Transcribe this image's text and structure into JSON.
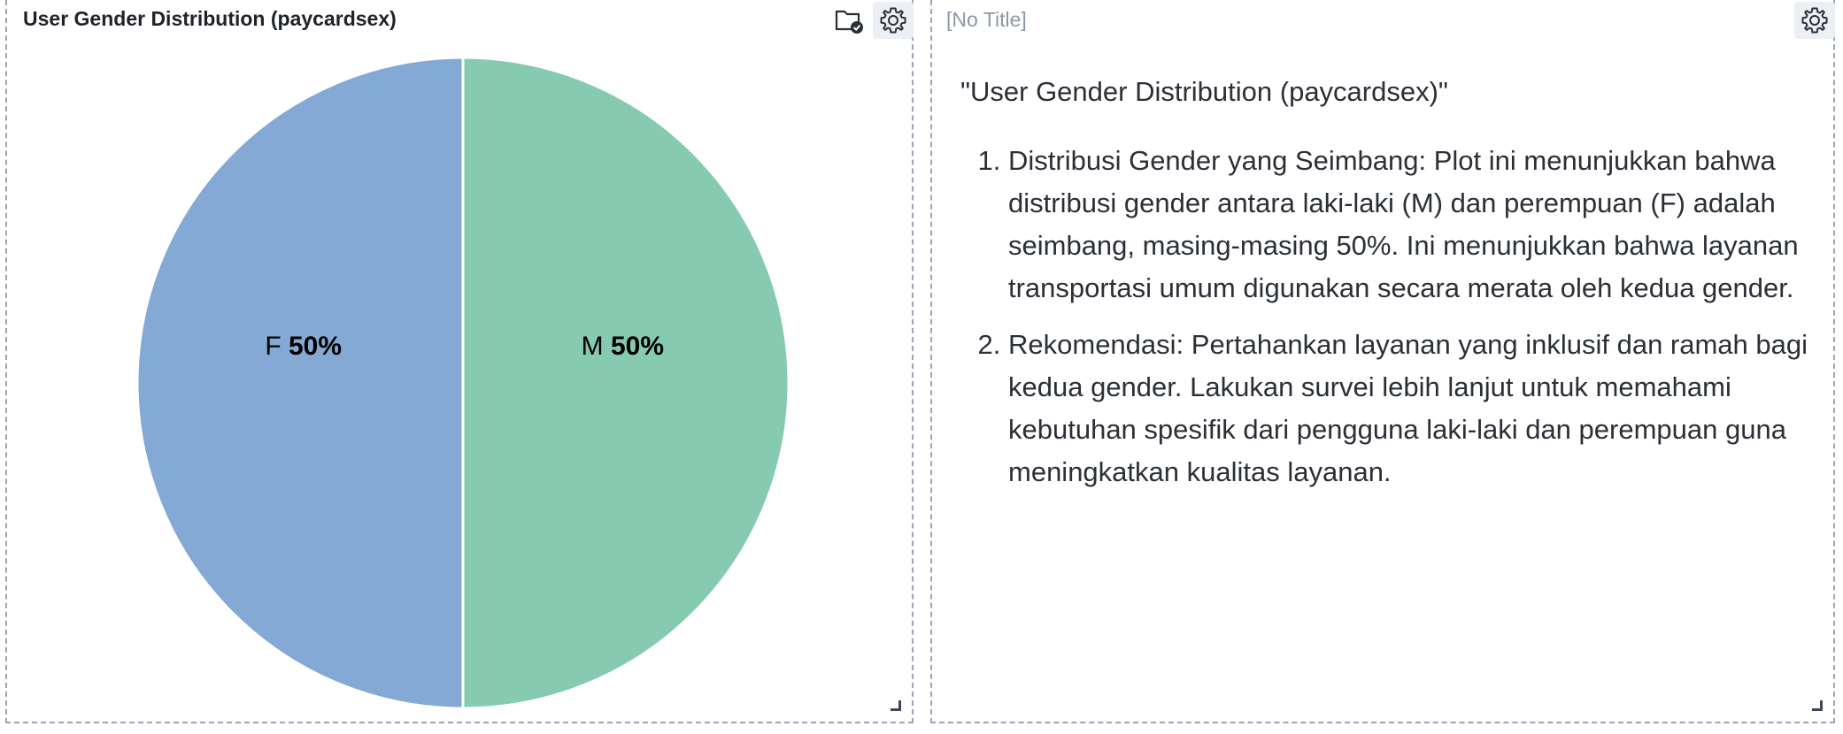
{
  "left_panel": {
    "title": "User Gender Distribution (paycardsex)",
    "icons": [
      "folder-check-icon",
      "gear-icon"
    ]
  },
  "right_panel": {
    "title": "[No Title]",
    "icons": [
      "gear-icon"
    ],
    "markdown": {
      "heading": "\"User Gender Distribution (paycardsex)\"",
      "items": [
        "Distribusi Gender yang Seimbang: Plot ini menunjukkan bahwa distribusi gender antara laki-laki (M) dan perempuan (F) adalah seimbang, masing-masing 50%. Ini menunjukkan bahwa layanan transportasi umum digunakan secara merata oleh kedua gender.",
        "Rekomendasi: Pertahankan layanan yang inklusif dan ramah bagi kedua gender. Lakukan survei lebih lanjut untuk memahami kebutuhan spesifik dari pengguna laki-laki dan perempuan guna meningkatkan kualitas layanan."
      ]
    }
  },
  "chart_data": {
    "type": "pie",
    "slices": [
      {
        "label": "M",
        "value": 50,
        "display": "50%",
        "color": "#85cab1"
      },
      {
        "label": "F",
        "value": 50,
        "display": "50%",
        "color": "#83a9d4"
      }
    ]
  },
  "colors": {
    "border": "#9aa6b6",
    "title_text": "#1f2328",
    "muted_text": "#8d98a7",
    "body_text": "#2b2f36"
  }
}
